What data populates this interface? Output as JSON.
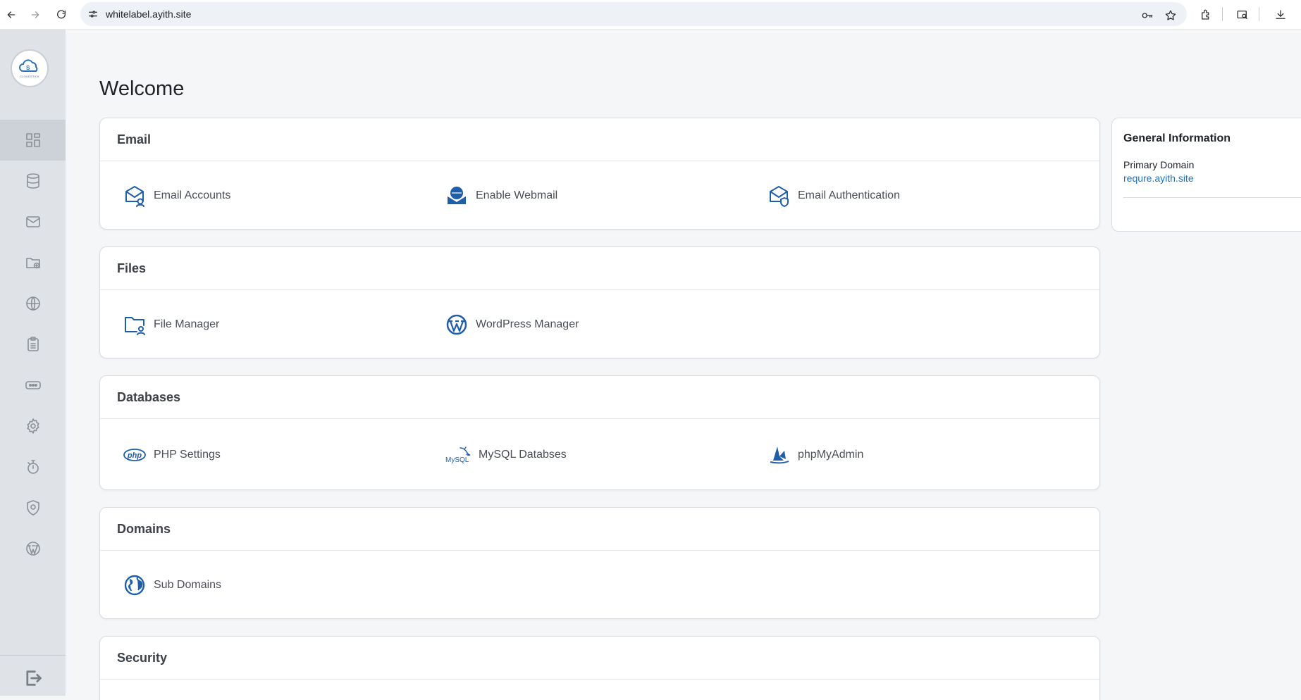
{
  "browser": {
    "url": "whitelabel.ayith.site"
  },
  "sidebar": {
    "logo_text": "CLOUDSTICK",
    "items": [
      {
        "icon": "dashboard-icon"
      },
      {
        "icon": "database-icon"
      },
      {
        "icon": "mail-icon"
      },
      {
        "icon": "folder-add-icon"
      },
      {
        "icon": "globe-icon"
      },
      {
        "icon": "clipboard-icon"
      },
      {
        "icon": "password-icon"
      },
      {
        "icon": "gear-icon"
      },
      {
        "icon": "timer-icon"
      },
      {
        "icon": "shield-icon"
      },
      {
        "icon": "wordpress-icon"
      }
    ],
    "logout_icon": "logout-icon"
  },
  "main": {
    "title": "Welcome",
    "sections": [
      {
        "title": "Email",
        "tools": [
          "Email Accounts",
          "Enable Webmail",
          "Email Authentication"
        ]
      },
      {
        "title": "Files",
        "tools": [
          "File Manager",
          "WordPress Manager"
        ]
      },
      {
        "title": "Databases",
        "tools": [
          "PHP Settings",
          "MySQL Databses",
          "phpMyAdmin"
        ]
      },
      {
        "title": "Domains",
        "tools": [
          "Sub Domains"
        ]
      },
      {
        "title": "Security",
        "tools": []
      }
    ]
  },
  "info_panel": {
    "title": "General Information",
    "primary_domain_label": "Primary Domain",
    "primary_domain_value": "requre.ayith.site"
  },
  "colors": {
    "accent": "#1f5fa8",
    "link": "#1a73c9",
    "sidebar_bg": "#dfe2e7"
  }
}
